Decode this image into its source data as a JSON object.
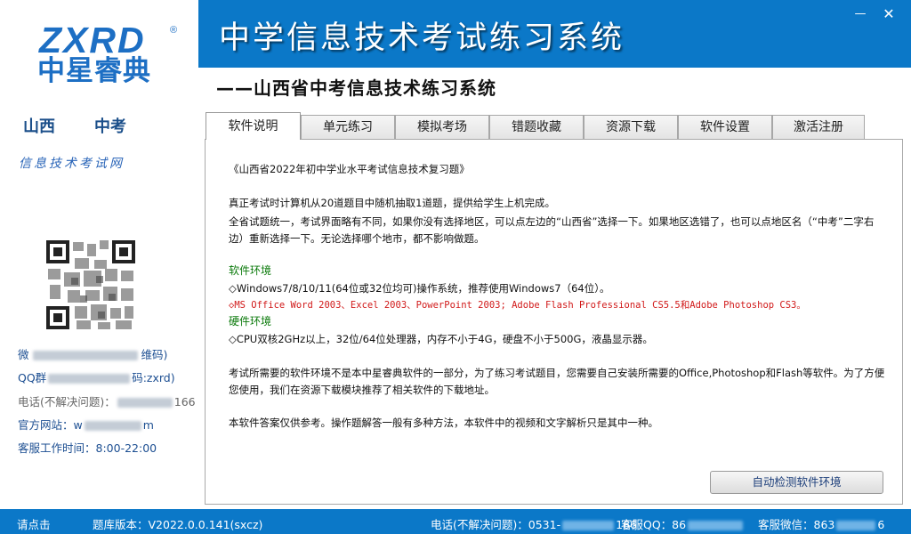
{
  "window": {
    "title": "中学信息技术考试练习系统",
    "subtitle": "——山西省中考信息技术练习系统",
    "min_glyph": "—",
    "close_glyph": "✕"
  },
  "logo": {
    "brand_en": "ZXRD",
    "reg_mark": "®",
    "brand_cn": "中星睿典"
  },
  "sidebar": {
    "region_province": "山西",
    "region_level": "中考",
    "slogan": "信息技术考试网",
    "contacts": {
      "wechat_prefix": "微",
      "wechat_suffix": "维码)",
      "qq_prefix": "QQ群",
      "qq_suffix": "码:zxrd)",
      "phone_prefix": "电话(不解决问题)：",
      "phone_suffix": "166",
      "site_prefix": "官方网站：w",
      "site_suffix": "m",
      "hours": "客服工作时间：8:00-22:00"
    }
  },
  "tabs": [
    {
      "label": "软件说明",
      "active": true
    },
    {
      "label": "单元练习",
      "active": false
    },
    {
      "label": "模拟考场",
      "active": false
    },
    {
      "label": "错题收藏",
      "active": false
    },
    {
      "label": "资源下载",
      "active": false
    },
    {
      "label": "软件设置",
      "active": false
    },
    {
      "label": "激活注册",
      "active": false
    }
  ],
  "content": {
    "heading": "《山西省2022年初中学业水平考试信息技术复习题》",
    "p1": "真正考试时计算机从20道题目中随机抽取1道题，提供给学生上机完成。",
    "p2": "全省试题统一，考试界面略有不同，如果你没有选择地区，可以点左边的“山西省”选择一下。如果地区选错了，也可以点地区名（“中考”二字右边）重新选择一下。无论选择哪个地市，都不影响做题。",
    "software_env_title": "软件环境",
    "software_env_1": "◇Windows7/8/10/11(64位或32位均可)操作系统，推荐使用Windows7（64位）。",
    "software_env_2": "◇MS Office Word 2003、Excel 2003、PowerPoint 2003; Adobe Flash Professional CS5.5和Adobe Photoshop CS3。",
    "hardware_env_title": "硬件环境",
    "hardware_env_1": "◇CPU双核2GHz以上，32位/64位处理器，内存不小于4G，硬盘不小于500G，液晶显示器。",
    "p3": "考试所需要的软件环境不是本中星睿典软件的一部分，为了练习考试题目，您需要自己安装所需要的Office,Photoshop和Flash等软件。为了方便您使用，我们在资源下载模块推荐了相关软件的下载地址。",
    "p4": "本软件答案仅供参考。操作题解答一般有多种方法，本软件中的视频和文字解析只是其中一种。",
    "check_button": "自动检测软件环境"
  },
  "statusbar": {
    "click_hint": "请点击",
    "version": "题库版本：V2022.0.0.141(sxcz)",
    "phone_prefix": "电话(不解决问题)：0531-",
    "phone_suffix": "166",
    "qq_prefix": "客服QQ：86",
    "wechat_prefix": "客服微信：863",
    "wechat_suffix": "6"
  },
  "colors": {
    "brand_blue": "#0b78c8",
    "logo_blue": "#1d6fc4",
    "env_green": "#0b7a0b",
    "warn_red": "#d11a1a"
  }
}
